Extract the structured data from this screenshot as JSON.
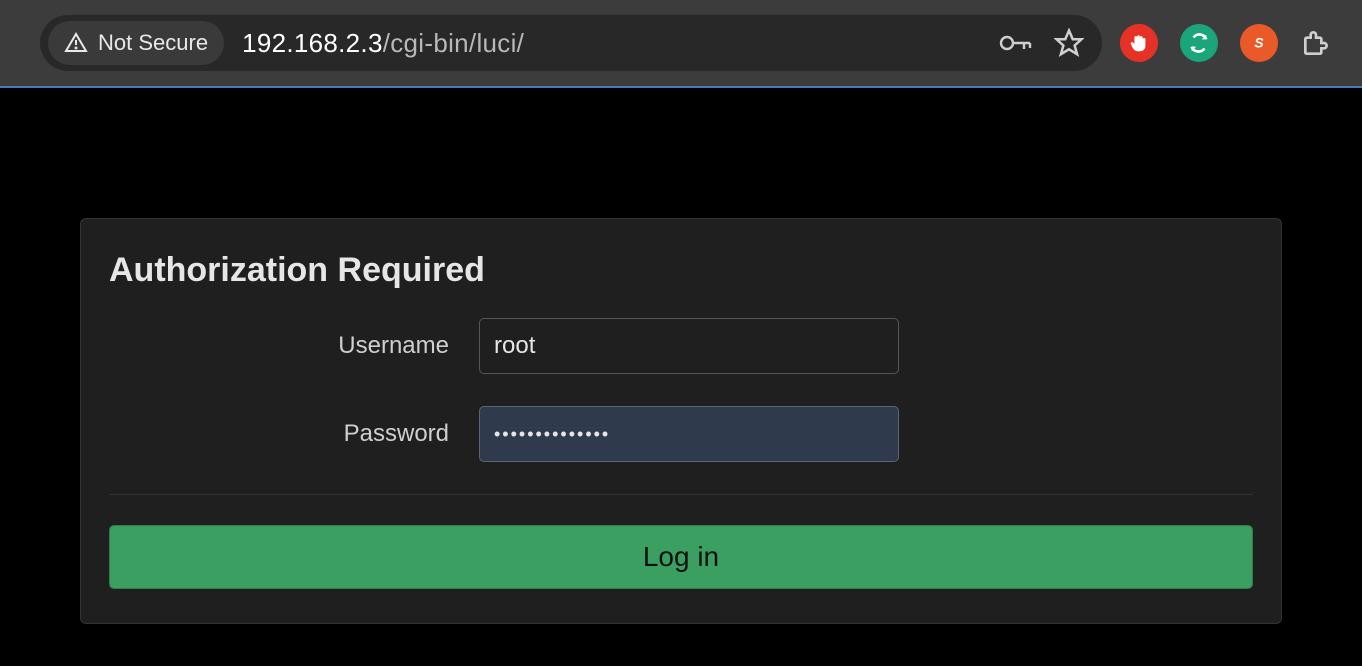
{
  "browser": {
    "not_secure_label": "Not Secure",
    "url_host": "192.168.2.3",
    "url_path": "/cgi-bin/luci/",
    "icons": {
      "warning": "warning-triangle-icon",
      "key": "key-icon",
      "star": "star-icon",
      "ext1": "hand-block-icon",
      "ext2": "sync-icon",
      "ext3": "lightning-icon",
      "puzzle": "puzzle-icon"
    }
  },
  "auth": {
    "title": "Authorization Required",
    "username_label": "Username",
    "username_value": "root",
    "password_label": "Password",
    "password_value": "••••••••••••••",
    "login_label": "Log in"
  }
}
